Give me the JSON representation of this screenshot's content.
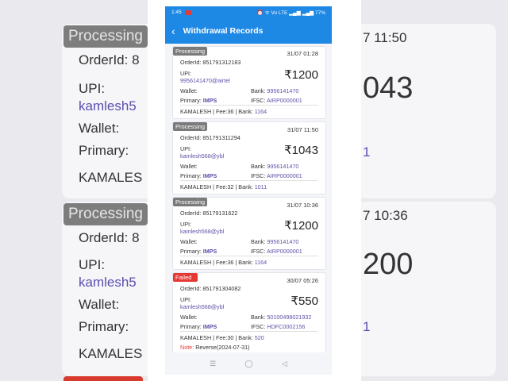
{
  "status_bar": {
    "time": "1:45",
    "indicators": "⏰ ᯤ Vo LTE ▂▄▆ ▂▄▆ 77%"
  },
  "app_bar": {
    "title": "Withdrawal Records"
  },
  "records": [
    {
      "status": "Processing",
      "datetime": "31/07 01:28",
      "order_id": "OrderId: 851791312183",
      "upi": "9956141470@airtel",
      "amount": "₹1200",
      "bank_account": "9956141470",
      "ifsc": "AIRP0000001",
      "primary": "IMPS",
      "name": "KAMALESH",
      "fee": "36",
      "bank_code": "1164"
    },
    {
      "status": "Processing",
      "datetime": "31/07 11:50",
      "order_id": "OrderId: 851791311294",
      "upi": "kamlesh568@ybl",
      "amount": "₹1043",
      "bank_account": "9956141470",
      "ifsc": "AIRP0000001",
      "primary": "IMPS",
      "name": "KAMALESH",
      "fee": "32",
      "bank_code": "1011"
    },
    {
      "status": "Processing",
      "datetime": "31/07 10:36",
      "order_id": "OrderId: 85179131622",
      "upi": "kamlesh568@ybl",
      "amount": "₹1200",
      "bank_account": "9956141470",
      "ifsc": "AIRP0000001",
      "primary": "IMPS",
      "name": "KAMALESH",
      "fee": "36",
      "bank_code": "1164"
    },
    {
      "status": "Failed",
      "datetime": "30/07 05:26",
      "order_id": "OrderId: 851791304082",
      "upi": "kamlesh568@ybl",
      "amount": "₹550",
      "bank_account": "50100498021932",
      "ifsc": "HDFC0002156",
      "primary": "IMPS",
      "name": "KAMALESH",
      "fee": "30",
      "bank_code": "520",
      "note": "Reverse(2024-07-31)"
    }
  ],
  "labels": {
    "upi": "UPI:",
    "wallet": "Wallet:",
    "bank": "Bank:",
    "primary": "Primary:",
    "ifsc": "IFSC:",
    "fee": "Fee:",
    "bank_short": "Bank:",
    "note": "Note:"
  },
  "background_zoom": {
    "status": "Processing",
    "order": "OrderId: 8",
    "upi_label": "UPI:",
    "upi_value": "kamlesh5",
    "wallet": "Wallet:",
    "primary": "Primary:",
    "name": "KAMALES",
    "time_1": "7 11:50",
    "amount_1": "043",
    "time_2": "7 10:36",
    "amount_2": "200"
  },
  "nav": {
    "menu": "☰",
    "home": "◯",
    "back": "◁"
  },
  "colors": {
    "accent": "#1e88e5",
    "processing": "#7a7a7a",
    "failed": "#e53935",
    "value": "#5d53a8"
  }
}
